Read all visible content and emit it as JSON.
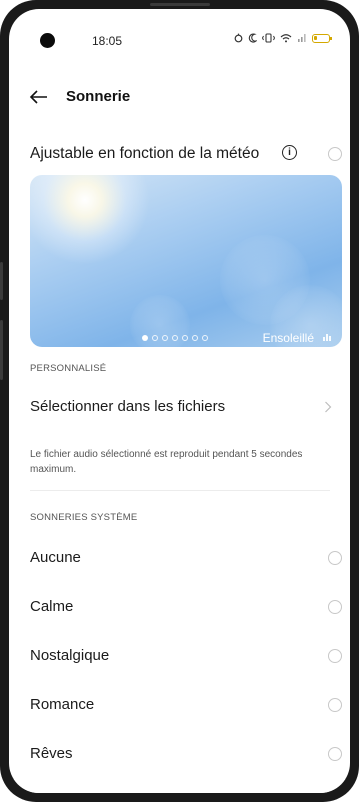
{
  "status": {
    "time": "18:05",
    "icons": [
      "alarm-icon",
      "do-not-disturb-icon",
      "vibrate-icon",
      "wifi-icon",
      "signal-icon",
      "battery-icon"
    ]
  },
  "header": {
    "title": "Sonnerie"
  },
  "weather": {
    "label": "Ajustable en fonction de la météo",
    "info_glyph": "i",
    "card": {
      "condition": "Ensoleillé",
      "page_count": 7,
      "active_page": 1
    }
  },
  "custom": {
    "section_label": "PERSONNALISÉ",
    "select_label": "Sélectionner dans les fichiers",
    "note": "Le fichier audio sélectionné est reproduit pendant 5 secondes maximum."
  },
  "system": {
    "section_label": "SONNERIES SYSTÈME",
    "items": [
      {
        "label": "Aucune"
      },
      {
        "label": "Calme"
      },
      {
        "label": "Nostalgique"
      },
      {
        "label": "Romance"
      },
      {
        "label": "Rêves"
      }
    ]
  },
  "colors": {
    "accent": "#d4a800",
    "sky_top": "#d5e6f6",
    "sky_bottom": "#7fb4e9"
  }
}
